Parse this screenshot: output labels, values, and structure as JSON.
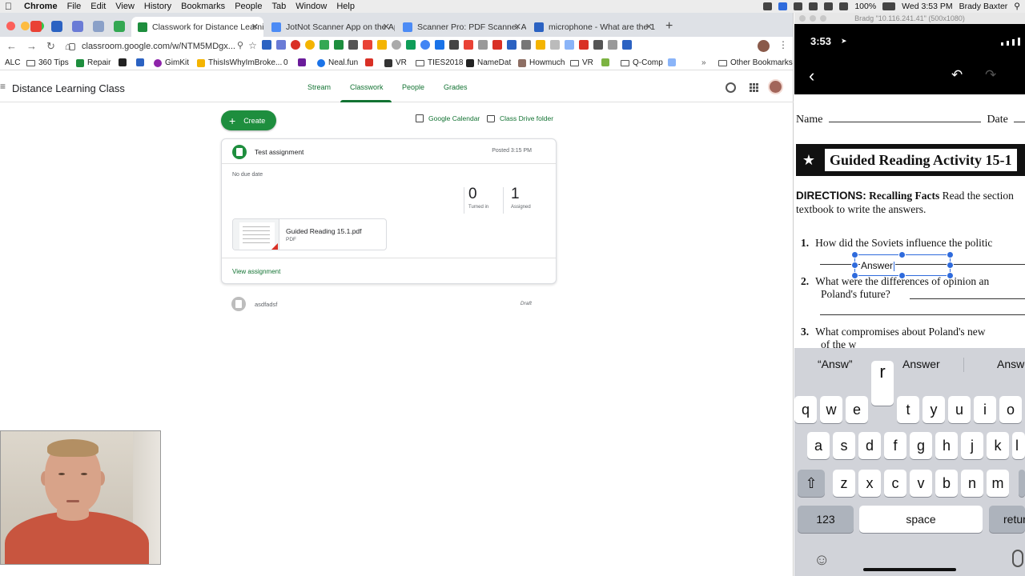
{
  "mac_menu": {
    "app": "Chrome",
    "items": [
      "File",
      "Edit",
      "View",
      "History",
      "Bookmarks",
      "People",
      "Tab",
      "Window",
      "Help"
    ],
    "status": {
      "battery": "100%",
      "datetime": "Wed 3:53 PM",
      "user": "Brady Baxter"
    }
  },
  "browser": {
    "tabs": [
      {
        "title": "Classwork for Distance Learnin",
        "active": true
      },
      {
        "title": "JotNot Scanner App on the Ap",
        "active": false
      },
      {
        "title": "Scanner Pro: PDF Scanner App",
        "active": false
      },
      {
        "title": "microphone - What are the 1 2",
        "active": false
      }
    ],
    "url": "classroom.google.com/w/NTM5MDgx...",
    "bookmarks": [
      {
        "label": "ALC",
        "kind": "text"
      },
      {
        "label": "360 Tips",
        "kind": "folder"
      },
      {
        "label": "Repair",
        "kind": "icon"
      },
      {
        "label": "GimKit",
        "kind": "icon"
      },
      {
        "label": "ThisIsWhyImBroke...",
        "kind": "icon"
      },
      {
        "label": "0",
        "kind": "text"
      },
      {
        "label": "Neal.fun",
        "kind": "icon"
      },
      {
        "label": "VR",
        "kind": "icon"
      },
      {
        "label": "TIES2018",
        "kind": "folder"
      },
      {
        "label": "NameDat",
        "kind": "icon"
      },
      {
        "label": "Howmuch",
        "kind": "icon"
      },
      {
        "label": "VR",
        "kind": "folder"
      },
      {
        "label": "Q-Comp",
        "kind": "folder"
      },
      {
        "label": "Other Bookmarks",
        "kind": "folder"
      }
    ]
  },
  "classroom": {
    "class_title": "Distance Learning Class",
    "tabs": [
      "Stream",
      "Classwork",
      "People",
      "Grades"
    ],
    "active_tab": "Classwork",
    "create_label": "Create",
    "calendar_link": "Google Calendar",
    "drive_link": "Class Drive folder",
    "assignment": {
      "title": "Test assignment",
      "posted": "Posted 3:15 PM",
      "due": "No due date",
      "turned_in": "0",
      "turned_in_label": "Turned in",
      "assigned": "1",
      "assigned_label": "Assigned",
      "attachment_name": "Guided Reading 15.1.pdf",
      "attachment_type": "PDF",
      "view_link": "View assignment"
    },
    "draft": {
      "title": "asdfadsf",
      "status": "Draft"
    }
  },
  "mirror": {
    "window_title": "Bradg \"10.116.241.41\" (500x1080)",
    "time": "3:53",
    "doc": {
      "name_label": "Name",
      "date_label": "Date",
      "banner_title": "Guided Reading Activity 15-1",
      "directions_bold": "DIRECTIONS:",
      "directions_bold2": "Recalling Facts",
      "directions_line1": "Read the section",
      "directions_line2": "textbook to write the answers.",
      "q1_num": "1.",
      "q1": "How did the Soviets influence the politic",
      "q2_num": "2.",
      "q2a": "What were the differences of opinion an",
      "q2b": "Poland's future?",
      "q3_num": "3.",
      "q3a": "What compromises about Poland's new",
      "q3b": "of the w",
      "annotation_text": "Answer"
    },
    "keyboard": {
      "suggestions": [
        "“Answ”",
        "Answer",
        "Answers"
      ],
      "popup_key": "r",
      "row1": [
        "q",
        "w",
        "e",
        "t",
        "y",
        "u",
        "i",
        "o"
      ],
      "row2": [
        "a",
        "s",
        "d",
        "f",
        "g",
        "h",
        "j",
        "k",
        "l"
      ],
      "row3": [
        "z",
        "x",
        "c",
        "v",
        "b",
        "n",
        "m"
      ],
      "numbers_key": "123",
      "space_key": "space",
      "return_key": "return"
    }
  }
}
